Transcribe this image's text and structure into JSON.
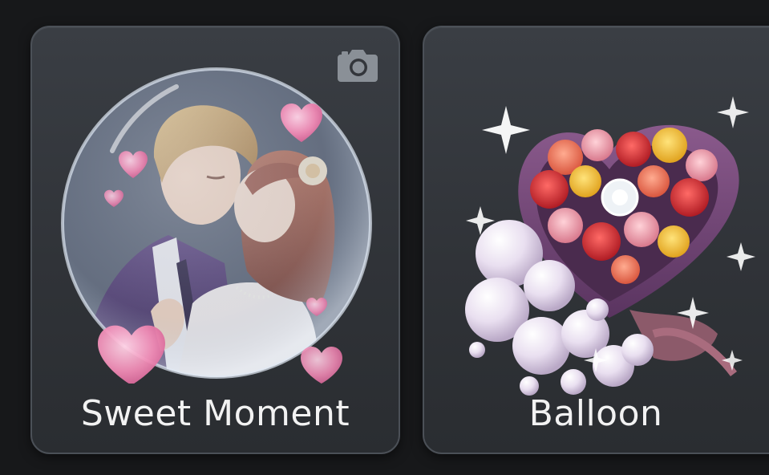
{
  "cards": [
    {
      "label": "Sweet Moment",
      "icon": "camera-icon",
      "artwork": "couple-kissing-in-bubble",
      "accent": "#e87aa8"
    },
    {
      "label": "Balloon",
      "artwork": "heart-flower-box-with-pearl-balloons",
      "accent": "#c9415a"
    }
  ],
  "colors": {
    "background": "#17181a",
    "card": "#33363b",
    "card_border": "#4b5057",
    "text": "#f2f2f2"
  }
}
